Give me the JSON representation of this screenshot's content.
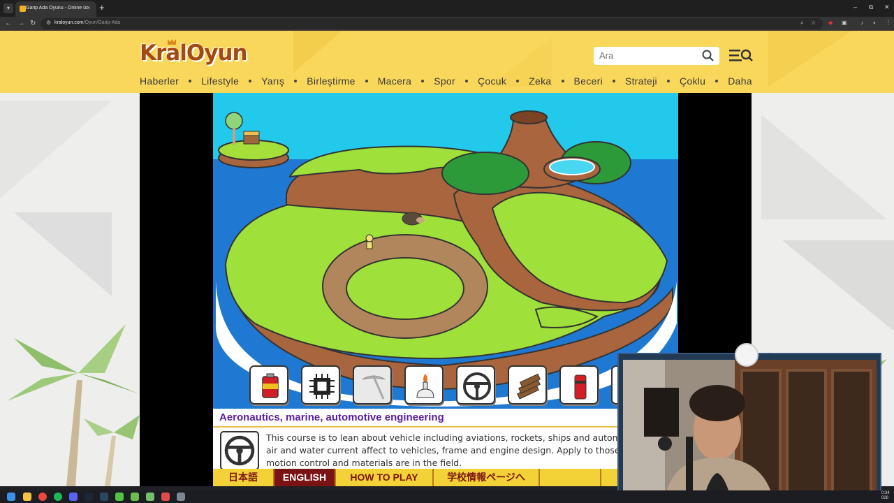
{
  "browser": {
    "tab_title": "Garip Ada Oyunu - Online ücre",
    "tab_close": "×",
    "new_tab": "+",
    "url_domain": "kraloyun.com",
    "url_path": "/Oyun/Garip-Ada",
    "window_controls": [
      "–",
      "⧉",
      "✕"
    ]
  },
  "site": {
    "logo_text": "KralOyun",
    "search_placeholder": "Ara",
    "categories": [
      "Haberler",
      "Lifestyle",
      "Yarış",
      "Birleştirme",
      "Macera",
      "Spor",
      "Çocuk",
      "Zeka",
      "Beceri",
      "Strateji",
      "Çoklu",
      "Daha"
    ]
  },
  "game": {
    "tools": [
      {
        "icon": "fuel-can-icon"
      },
      {
        "icon": "microchip-icon"
      },
      {
        "icon": "pickaxe-icon",
        "selected": true
      },
      {
        "icon": "bunsen-burner-icon"
      },
      {
        "icon": "steering-wheel-icon"
      },
      {
        "icon": "logs-icon"
      },
      {
        "icon": "lighthouse-icon"
      }
    ],
    "course": {
      "title": "Aeronautics, marine, automotive engineering",
      "desc_line1": "This course is to lean about vehicle including aviations, rockets, ships and automobile",
      "desc_line2": "air and water current affect to vehicles, frame and engine design. Apply to those stud",
      "desc_line3": "motion control and materials are in the field."
    },
    "menu": [
      "日本語",
      "ENGLISH",
      "HOW TO PLAY",
      "学校情報ページへ",
      "",
      ""
    ],
    "active_menu": "ENGLISH"
  },
  "taskbar": {
    "clock_time": "0:34",
    "clock_date": "026"
  },
  "colors": {
    "header": "#f9d75b",
    "accent_dark_red": "#7a1414",
    "course_title": "#5a1fa0"
  }
}
